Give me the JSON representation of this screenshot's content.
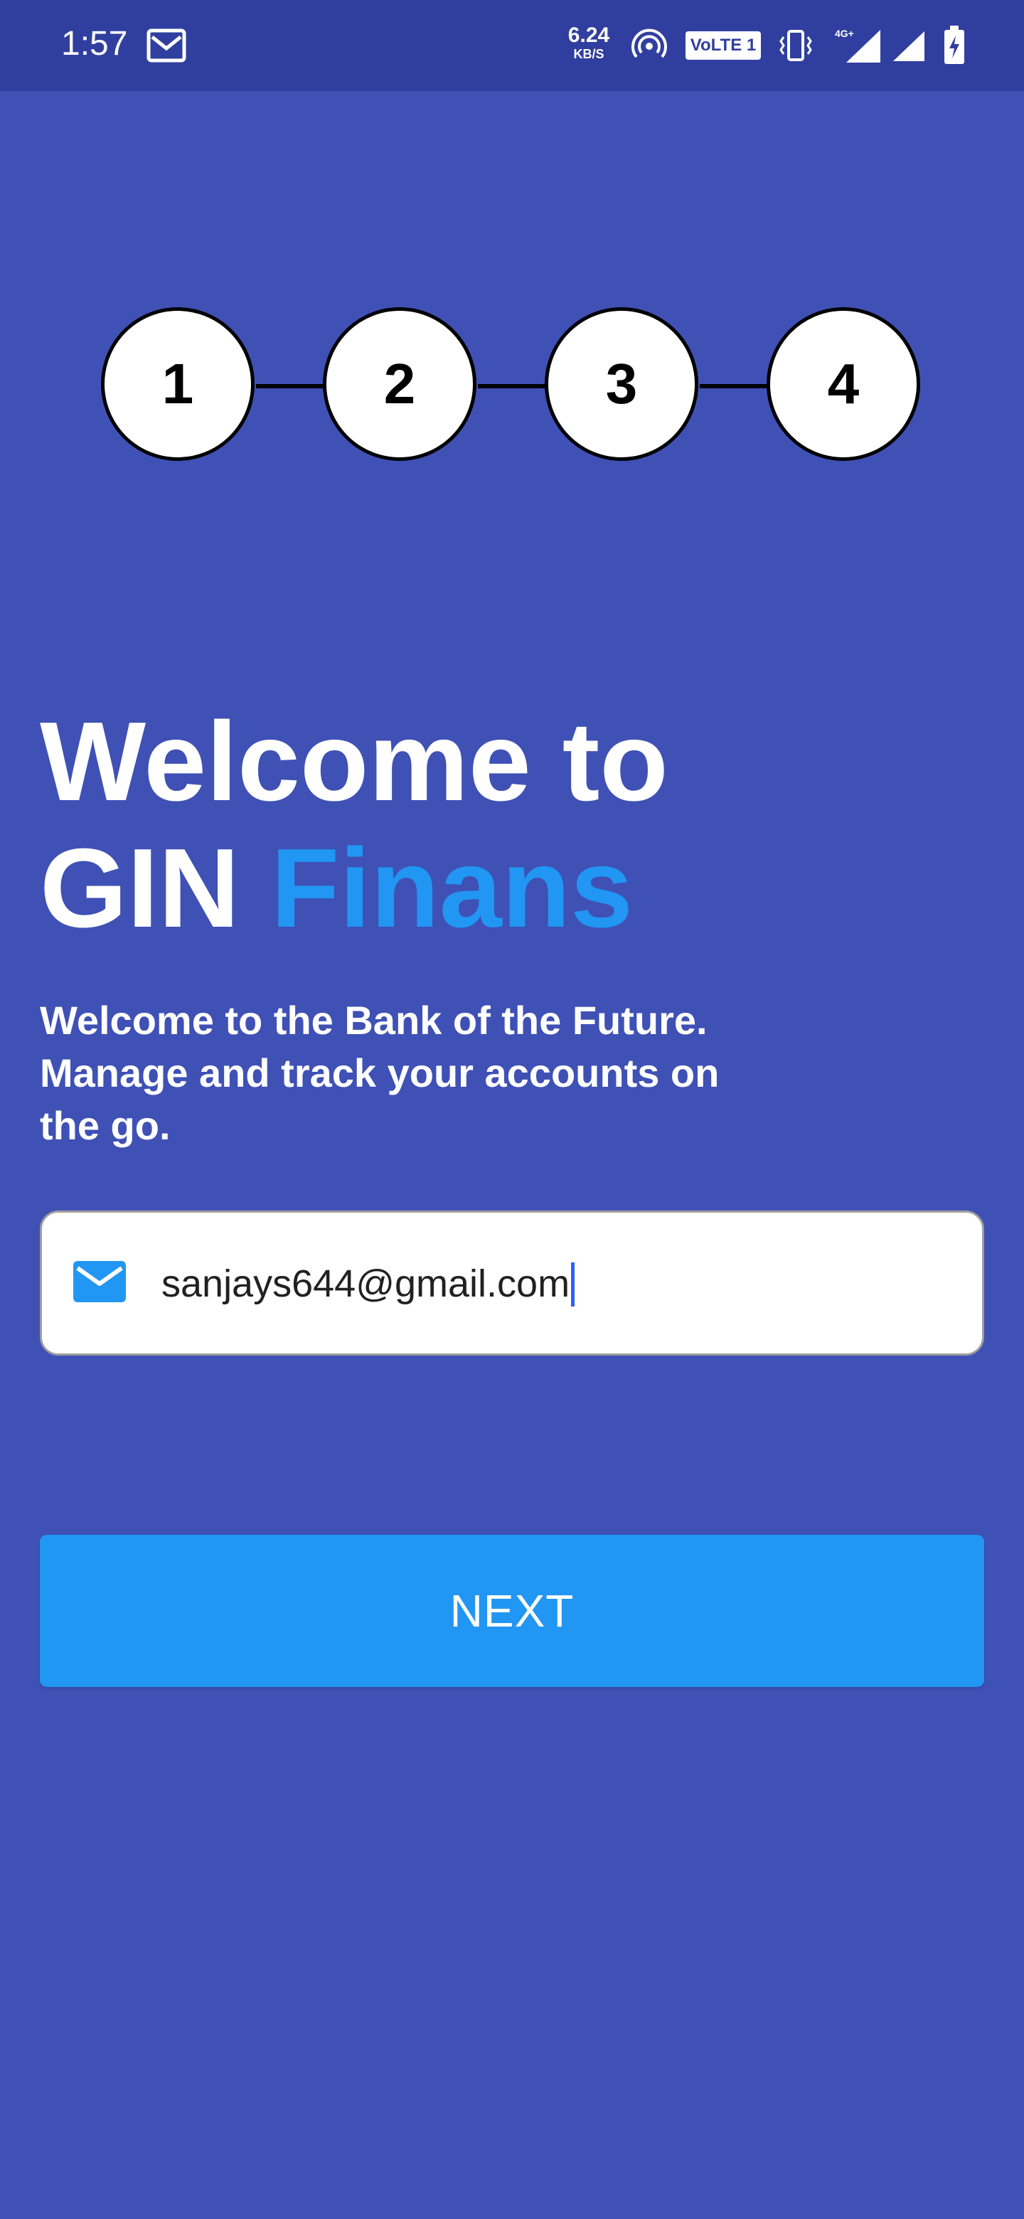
{
  "status_bar": {
    "time": "1:57",
    "net_speed_value": "6.24",
    "net_speed_unit": "KB/S",
    "volte_label": "VoLTE 1",
    "network_type": "4G+",
    "icons": [
      "gmail-icon",
      "hotspot-icon",
      "vibrate-icon",
      "signal-icon",
      "battery-charging-icon"
    ]
  },
  "stepper": {
    "steps": [
      "1",
      "2",
      "3",
      "4"
    ]
  },
  "header": {
    "title_line1": "Welcome to",
    "title_brand_first": "GIN",
    "title_brand_second": "Finans",
    "subtitle": "Welcome to the Bank of the Future.\nManage and track your accounts on\n the go."
  },
  "form": {
    "email_value": "sanjays644@gmail.com",
    "email_icon": "mail-icon"
  },
  "actions": {
    "next_label": "NEXT"
  },
  "colors": {
    "background": "#3F51B5",
    "status_bar": "#303F9F",
    "accent": "#2196F3",
    "button": "#2196F3"
  }
}
